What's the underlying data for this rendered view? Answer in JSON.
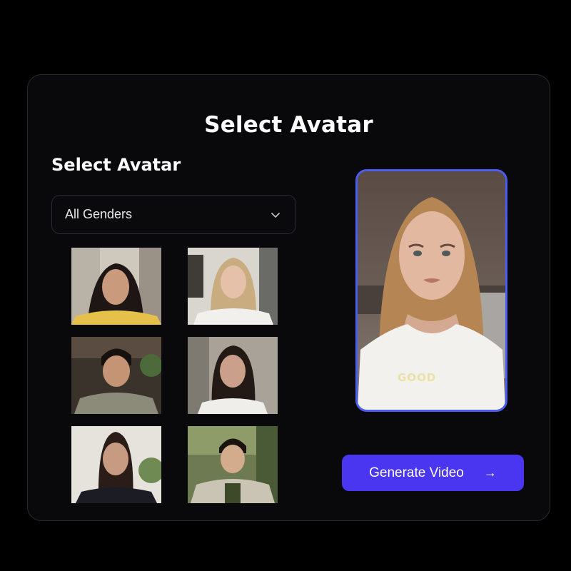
{
  "panel": {
    "title": "Select Avatar",
    "section_title": "Select Avatar"
  },
  "gender_filter": {
    "value": "All Genders",
    "icon": "chevron-down-icon"
  },
  "avatars": [
    {
      "id": "avatar-1",
      "description": "woman with dark curly hair, yellow top"
    },
    {
      "id": "avatar-2",
      "description": "woman with long blonde hair, white top"
    },
    {
      "id": "avatar-3",
      "description": "man with short dark hair, olive shirt"
    },
    {
      "id": "avatar-4",
      "description": "woman with long dark hair, white top"
    },
    {
      "id": "avatar-5",
      "description": "woman with dark hair pulled back, dark top"
    },
    {
      "id": "avatar-6",
      "description": "man outdoors, light jacket"
    }
  ],
  "preview": {
    "shirt_text": "GOOD"
  },
  "actions": {
    "generate_label": "Generate Video",
    "generate_icon": "arrow-right-icon"
  },
  "colors": {
    "accent": "#4a35f0",
    "preview_border": "#4b5cf0",
    "background": "#000000",
    "panel": "#09090b"
  }
}
